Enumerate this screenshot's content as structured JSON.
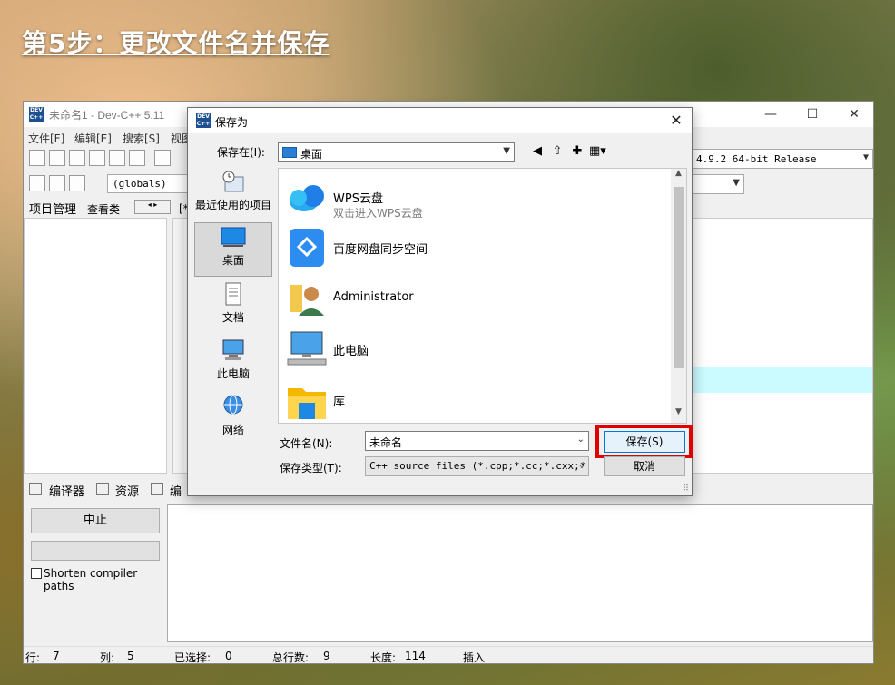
{
  "step_title": "第5步：更改文件名并保存",
  "main_window": {
    "title": "未命名1 - Dev-C++ 5.11",
    "controls": {
      "minimize": "—",
      "maximize": "☐",
      "close": "✕"
    },
    "menu": [
      "文件[F]",
      "编辑[E]",
      "搜索[S]",
      "视图"
    ],
    "globals": "(globals)",
    "compiler_set": "4.9.2 64-bit Release",
    "left_tabs": {
      "project": "项目管理",
      "class": "查看类"
    },
    "editor_tab": "[*",
    "bottom_tabs": {
      "compiler": "编译器",
      "resources": "资源",
      "compile_log": "编"
    },
    "abort_button": "中止",
    "shorten_paths": "Shorten compiler paths",
    "status": {
      "line_label": "行:",
      "line": "7",
      "col_label": "列:",
      "col": "5",
      "sel_label": "已选择:",
      "sel": "0",
      "total_label": "总行数:",
      "total": "9",
      "len_label": "长度:",
      "len": "114",
      "mode": "插入"
    }
  },
  "dialog": {
    "title": "保存为",
    "save_in_label": "保存在(I):",
    "save_in_value": "桌面",
    "places": [
      {
        "label": "最近使用的项目",
        "icon": "recent-icon"
      },
      {
        "label": "桌面",
        "icon": "desktop-icon",
        "active": true
      },
      {
        "label": "文档",
        "icon": "documents-icon"
      },
      {
        "label": "此电脑",
        "icon": "computer-icon"
      },
      {
        "label": "网络",
        "icon": "network-icon"
      }
    ],
    "files": [
      {
        "name": "WPS云盘",
        "sub": "双击进入WPS云盘",
        "icon": "wps-cloud-icon"
      },
      {
        "name": "百度网盘同步空间",
        "sub": "",
        "icon": "baidu-netdisk-icon"
      },
      {
        "name": "Administrator",
        "sub": "",
        "icon": "user-folder-icon"
      },
      {
        "name": "此电脑",
        "sub": "",
        "icon": "computer-icon"
      },
      {
        "name": "库",
        "sub": "",
        "icon": "library-icon"
      }
    ],
    "filename_label": "文件名(N):",
    "filename_value": "未命名",
    "filetype_label": "保存类型(T):",
    "filetype_value": "C++ source files (*.cpp;*.cc;*.cxx;*.",
    "save_button": "保存(S)",
    "cancel_button": "取消",
    "highlight_color": "#e00000"
  }
}
